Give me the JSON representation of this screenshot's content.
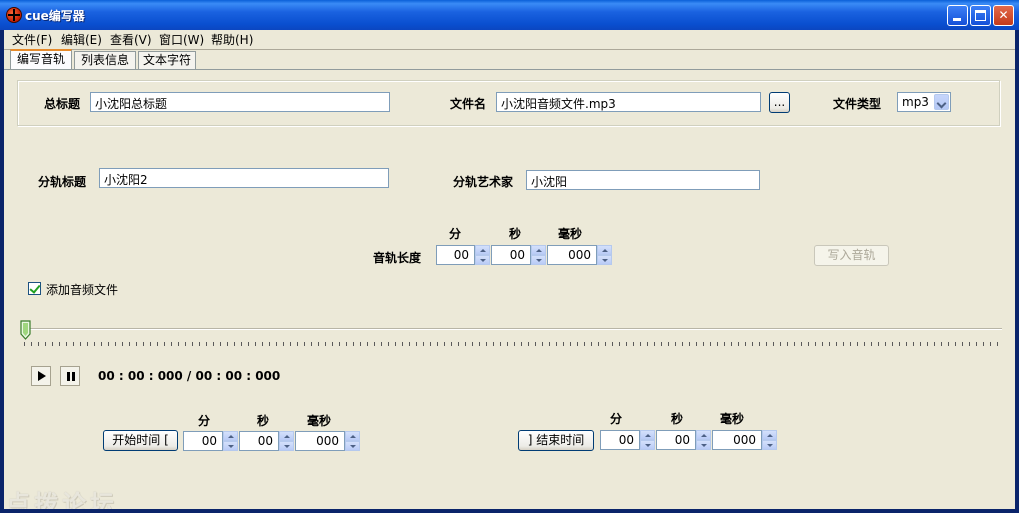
{
  "window": {
    "title": "cue编写器"
  },
  "menu": [
    {
      "label": "文件(F)"
    },
    {
      "label": "编辑(E)"
    },
    {
      "label": "查看(V)"
    },
    {
      "label": "窗口(W)"
    },
    {
      "label": "帮助(H)"
    }
  ],
  "tabs": [
    {
      "label": "编写音轨",
      "active": true
    },
    {
      "label": "列表信息",
      "active": false
    },
    {
      "label": "文本字符",
      "active": false
    }
  ],
  "album": {
    "title_label": "总标题",
    "title_value": "小沈阳总标题",
    "file_label": "文件名",
    "file_value": "小沈阳音频文件.mp3",
    "browse_label": "...",
    "type_label": "文件类型",
    "type_value": "mp3"
  },
  "track": {
    "title_label": "分轨标题",
    "title_value": "小沈阳2",
    "artist_label": "分轨艺术家",
    "artist_value": "小沈阳",
    "length_label": "音轨长度",
    "units": {
      "min": "分",
      "sec": "秒",
      "ms": "毫秒"
    },
    "length": {
      "min": "00",
      "sec": "00",
      "ms": "000"
    },
    "write_button": "写入音轨",
    "add_audio_label": "添加音频文件",
    "add_audio_checked": true
  },
  "player": {
    "position": 0,
    "timecode": "00 : 00 : 000 / 00 : 00 : 000"
  },
  "start": {
    "button": "开始时间 [",
    "min": "00",
    "sec": "00",
    "ms": "000"
  },
  "end": {
    "button": "] 结束时间",
    "min": "00",
    "sec": "00",
    "ms": "000"
  },
  "watermark": "点拨论坛",
  "colors": {
    "titlebar": "#0A4FD0",
    "window_bg": "#ECE9D8",
    "active_tab_accent": "#E68B2C"
  }
}
